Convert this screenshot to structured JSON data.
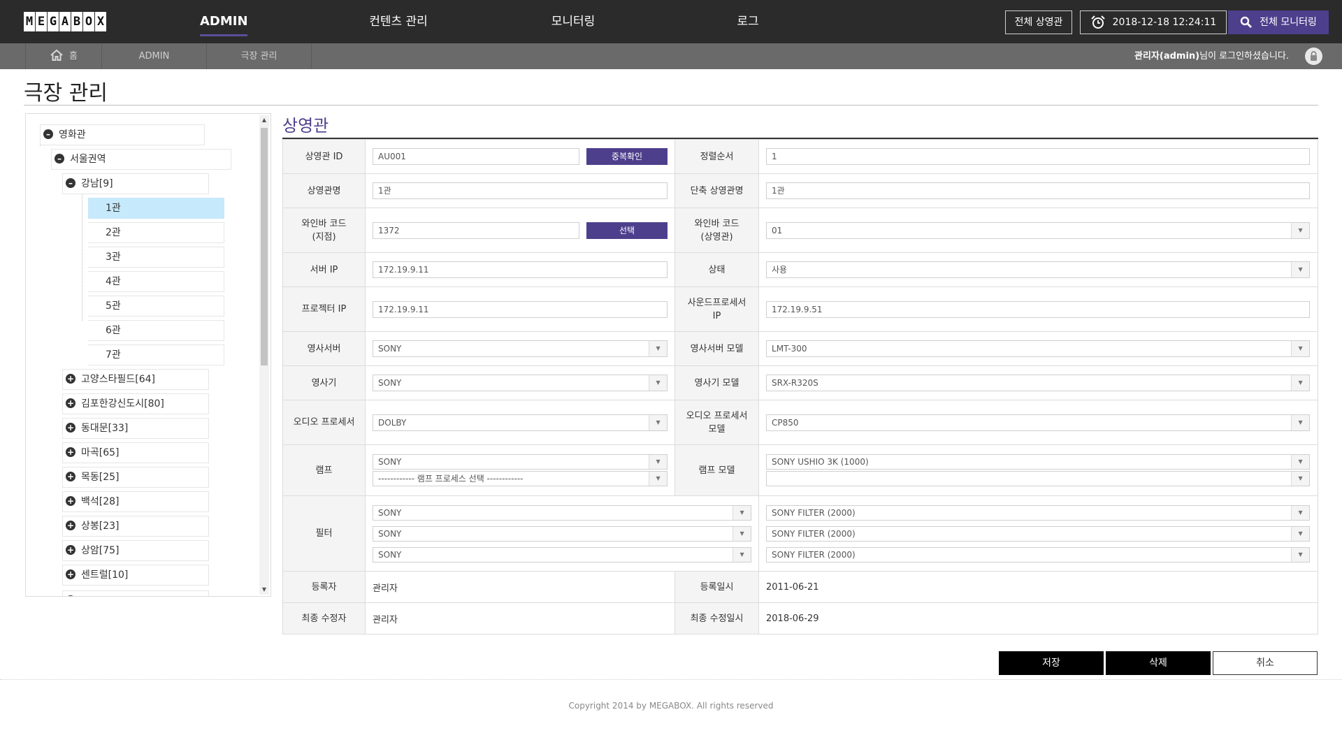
{
  "header": {
    "logo_letters": [
      "M",
      "E",
      "G",
      "A",
      "B",
      "O",
      "X"
    ],
    "nav": [
      {
        "label": "ADMIN",
        "active": true
      },
      {
        "label": "컨텐츠 관리",
        "active": false
      },
      {
        "label": "모니터링",
        "active": false
      },
      {
        "label": "로그",
        "active": false
      }
    ],
    "all_screens_button": "전체 상영관",
    "clock_icon": "alarm-clock-icon",
    "datetime": "2018-12-18 12:24:11",
    "monitoring_button": "전체 모니터링",
    "accent_color": "#4e3f8c"
  },
  "breadcrumb": {
    "home": "홈",
    "items": [
      "ADMIN",
      "극장 관리"
    ],
    "login_user": "관리자(admin)",
    "login_suffix": "님이 로그인하셨습니다."
  },
  "page": {
    "title": "극장 관리",
    "section_title": "상영관"
  },
  "tree": {
    "root": "영화관",
    "region": "서울권역",
    "branch": "강남[9]",
    "screens": [
      "1관",
      "2관",
      "3관",
      "4관",
      "5관",
      "6관",
      "7관"
    ],
    "selected": "1관",
    "other_branches": [
      "고양스타필드[64]",
      "김포한강신도시[80]",
      "동대문[33]",
      "마곡[65]",
      "목동[25]",
      "백석[28]",
      "상봉[23]",
      "상암[75]",
      "센트럴[10]"
    ]
  },
  "form": {
    "screen_id": {
      "label": "상영관 ID",
      "value": "AU001",
      "button": "중복확인"
    },
    "sort_order": {
      "label": "정렬순서",
      "value": "1"
    },
    "screen_name": {
      "label": "상영관명",
      "value": "1관"
    },
    "short_name": {
      "label": "단축 상영관명",
      "value": "1관"
    },
    "winebar_branch": {
      "label1": "와인바 코드",
      "label2": "(지점)",
      "value": "1372",
      "button": "선택"
    },
    "winebar_screen": {
      "label1": "와인바 코드",
      "label2": "(상영관)",
      "value": "01"
    },
    "server_ip": {
      "label": "서버 IP",
      "value": "172.19.9.11"
    },
    "status": {
      "label": "상태",
      "value": "사용"
    },
    "projector_ip": {
      "label": "프로젝터 IP",
      "value": "172.19.9.11"
    },
    "sound_ip": {
      "label1": "사운드프로세서",
      "label2": "IP",
      "value": "172.19.9.51"
    },
    "video_server": {
      "label": "영사서버",
      "value": "SONY"
    },
    "video_server_model": {
      "label": "영사서버 모델",
      "value": "LMT-300"
    },
    "projector": {
      "label": "영사기",
      "value": "SONY"
    },
    "projector_model": {
      "label": "영사기 모델",
      "value": "SRX-R320S"
    },
    "audio_processor": {
      "label": "오디오 프로세서",
      "value": "DOLBY"
    },
    "audio_processor_model": {
      "label1": "오디오 프로세서",
      "label2": "모델",
      "value": "CP850"
    },
    "lamp": {
      "label": "램프",
      "value": "SONY",
      "process": "------------ 램프 프로세스 선택 ------------"
    },
    "lamp_model": {
      "label": "램프 모델",
      "value": "SONY USHIO 3K (1000)",
      "value2": ""
    },
    "filter": {
      "label": "필터",
      "values": [
        "SONY",
        "SONY",
        "SONY"
      ],
      "models": [
        "SONY FILTER (2000)",
        "SONY FILTER (2000)",
        "SONY FILTER (2000)"
      ]
    },
    "registrant": {
      "label": "등록자",
      "value": "관리자"
    },
    "registered_at": {
      "label": "등록일시",
      "value": "2011-06-21"
    },
    "last_editor": {
      "label": "최종 수정자",
      "value": "관리자"
    },
    "last_edited_at": {
      "label": "최종 수정일시",
      "value": "2018-06-29"
    }
  },
  "actions": {
    "save": "저장",
    "delete": "삭제",
    "cancel": "취소"
  },
  "footer": {
    "copyright": "Copyright 2014 by MEGABOX. All rights reserved"
  }
}
